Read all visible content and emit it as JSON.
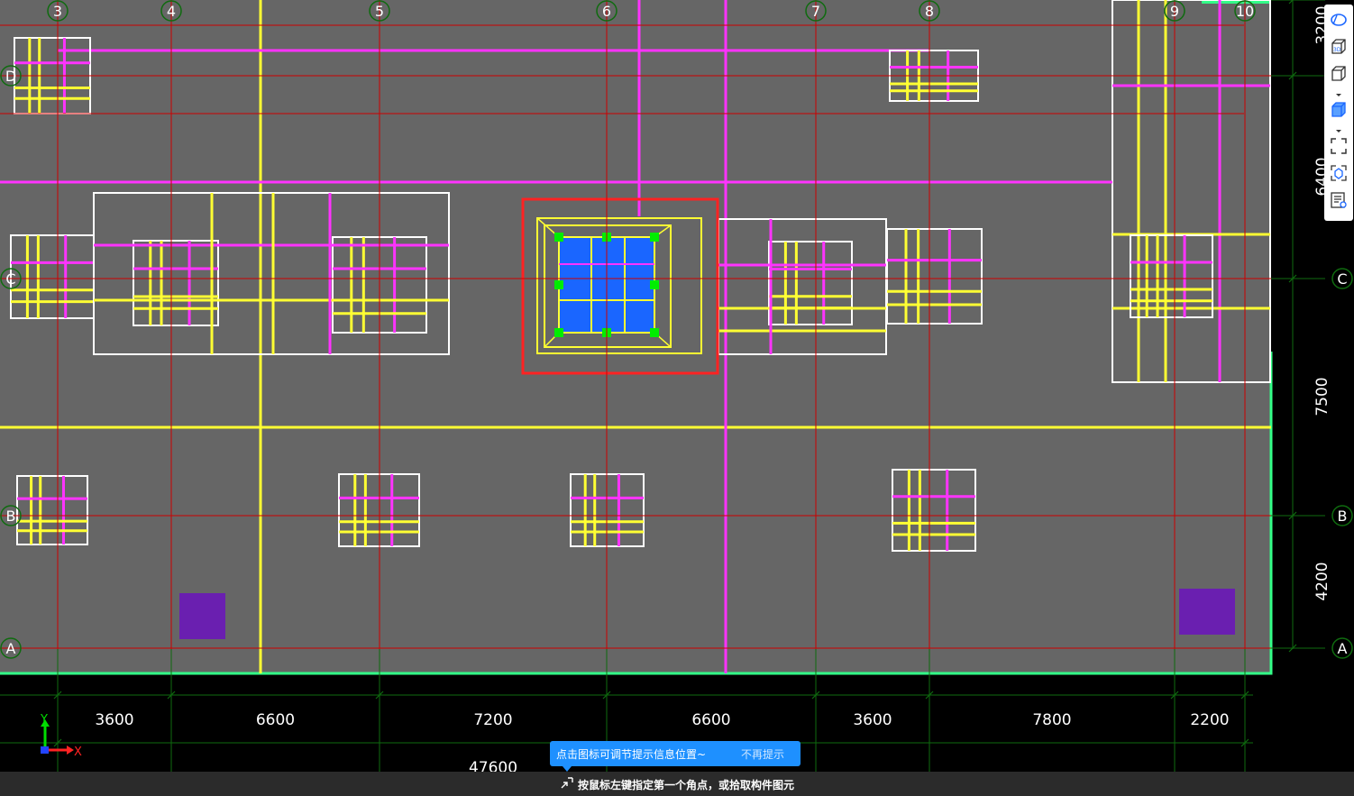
{
  "axes_columns": [
    "3",
    "4",
    "5",
    "6",
    "7",
    "8",
    "9",
    "10"
  ],
  "axes_rows": [
    "D",
    "C",
    "B",
    "A"
  ],
  "bay_widths": [
    "3600",
    "6600",
    "7200",
    "6600",
    "3600",
    "7800",
    "2200"
  ],
  "total_length": "47600",
  "bay_heights": [
    "3200",
    "6400",
    "7500",
    "4200"
  ],
  "coord_labels": {
    "x": "X",
    "y": "Y"
  },
  "tooltip": {
    "message": "点击图标可调节提示信息位置~",
    "dismiss": "不再提示"
  },
  "status": {
    "prompt": "按鼠标左键指定第一个角点，或拾取构件图元"
  },
  "toolbar": {
    "items": [
      "orbit-icon",
      "3d-view-icon",
      "box-view-icon",
      "solid-view-icon",
      "fit-view-icon",
      "element-view-icon",
      "layer-list-icon"
    ]
  },
  "colors": {
    "background": "#000000",
    "slab": "#666666",
    "grid": "#cc0000",
    "dim": "#0f6b0f",
    "beam_yellow": "#ffff33",
    "beam_magenta": "#ff33ff",
    "outline": "#ffffff",
    "selected": "#1a66ff",
    "handle": "#00ee00",
    "select_frame": "#ff2222",
    "purple": "#6a1fb0",
    "slab_edge": "#33ff88"
  }
}
